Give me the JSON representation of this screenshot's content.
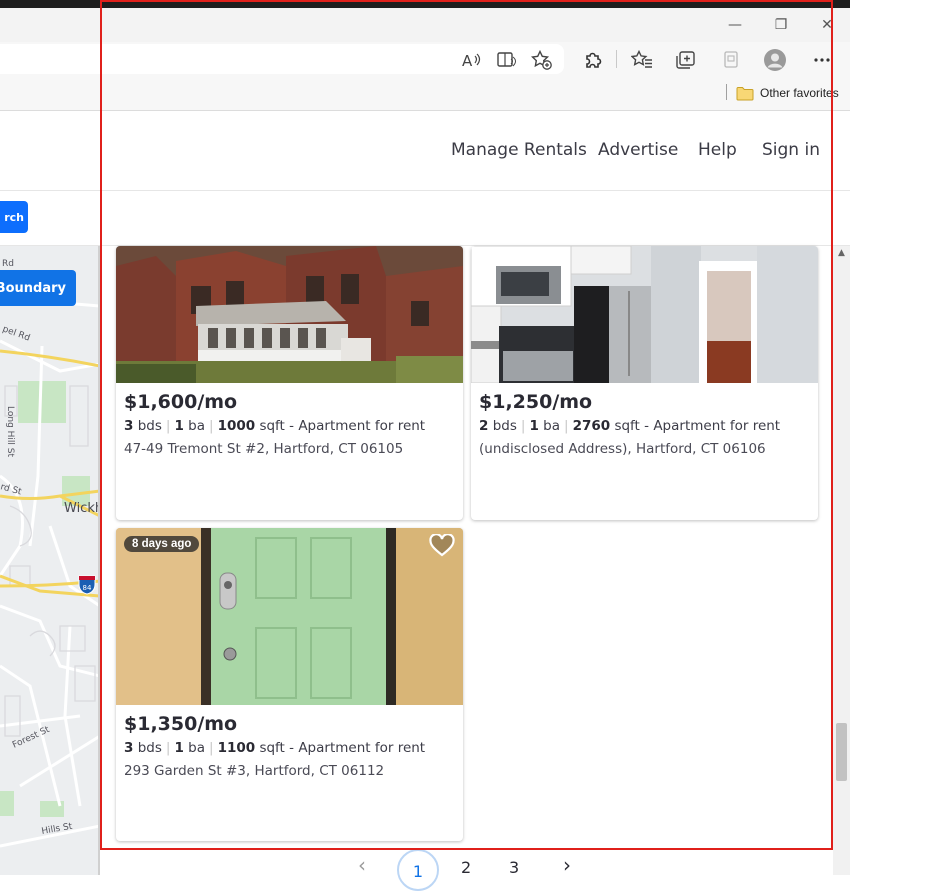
{
  "browser": {
    "window_controls": {
      "minimize": "—",
      "restore": "❐",
      "close": "✕"
    },
    "favorites_bar": {
      "folder_label": "Other favorites"
    },
    "toolbar_icons": [
      "read-aloud-icon",
      "immersive-reader-icon",
      "add-favorite-icon",
      "extensions-icon",
      "favorites-icon",
      "collections-icon",
      "sidebar-icon",
      "profile-icon",
      "more-icon"
    ]
  },
  "site_header": {
    "nav": {
      "manage_rentals": "Manage Rentals",
      "advertise": "Advertise",
      "help": "Help",
      "sign_in": "Sign in"
    }
  },
  "filters": {
    "search_button_fragment": "rch"
  },
  "map": {
    "boundary_button_fragment": "Boundary",
    "labels": {
      "rd_top": "Rd",
      "pel_rd": "pel Rd",
      "long_hill_st": "Long Hill St",
      "rd_st": "rd St",
      "wickh": "Wickh",
      "highway": "84",
      "forest_st": "Forest St",
      "hills_st": "Hills St"
    }
  },
  "listings": [
    {
      "price": "$1,600/mo",
      "beds": "3",
      "beds_unit": "bds",
      "baths": "1",
      "baths_unit": "ba",
      "sqft": "1000",
      "sqft_unit": "sqft",
      "type": "- Apartment for rent",
      "address": "47-49 Tremont St #2, Hartford, CT 06105"
    },
    {
      "price": "$1,250/mo",
      "beds": "2",
      "beds_unit": "bds",
      "baths": "1",
      "baths_unit": "ba",
      "sqft": "2760",
      "sqft_unit": "sqft",
      "type": "- Apartment for rent",
      "address": "(undisclosed Address), Hartford, CT 06106"
    },
    {
      "badge": "8 days ago",
      "price": "$1,350/mo",
      "beds": "3",
      "beds_unit": "bds",
      "baths": "1",
      "baths_unit": "ba",
      "sqft": "1100",
      "sqft_unit": "sqft",
      "type": "- Apartment for rent",
      "address": "293 Garden St #3, Hartford, CT 06112"
    }
  ],
  "pagination": {
    "prev": "‹",
    "pages": [
      "1",
      "2",
      "3"
    ],
    "current": "1",
    "next": "›"
  },
  "colors": {
    "accent": "#1173e6",
    "highlight_box": "#e0201b"
  }
}
